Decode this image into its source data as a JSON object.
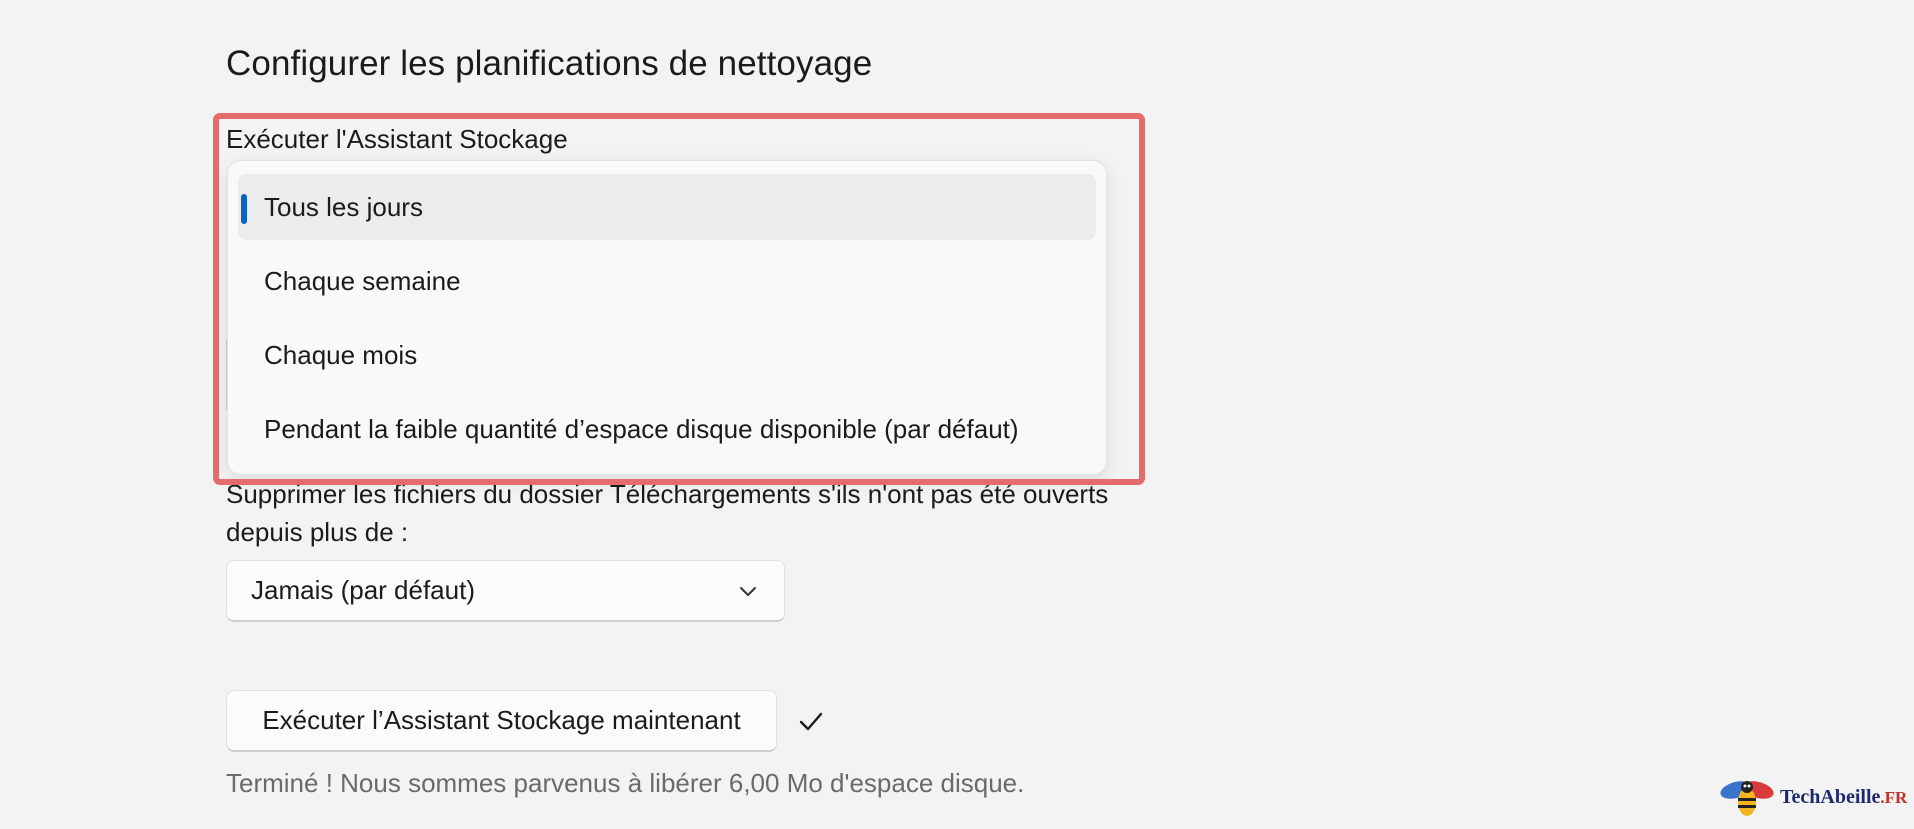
{
  "section": {
    "title": "Configurer les planifications de nettoyage"
  },
  "storage_sense": {
    "label": "Exécuter l'Assistant Stockage",
    "options": [
      "Tous les jours",
      "Chaque semaine",
      "Chaque mois",
      "Pendant la faible quantité d’espace disque disponible (par défaut)"
    ],
    "selected_index": 0
  },
  "downloads": {
    "description": "Supprimer les fichiers du dossier Téléchargements s'ils n'ont pas été ouverts depuis plus de :",
    "value": "Jamais (par défaut)"
  },
  "actions": {
    "run_now_label": "Exécuter l’Assistant Stockage maintenant",
    "status": "Terminé ! Nous sommes parvenus à libérer 6,00 Mo d'espace disque."
  },
  "watermark": {
    "name": "TechAbeille",
    "tld": ".FR"
  },
  "colors": {
    "accent": "#0a63c4",
    "highlight": "#e46c6c",
    "background": "#f3f3f3"
  }
}
